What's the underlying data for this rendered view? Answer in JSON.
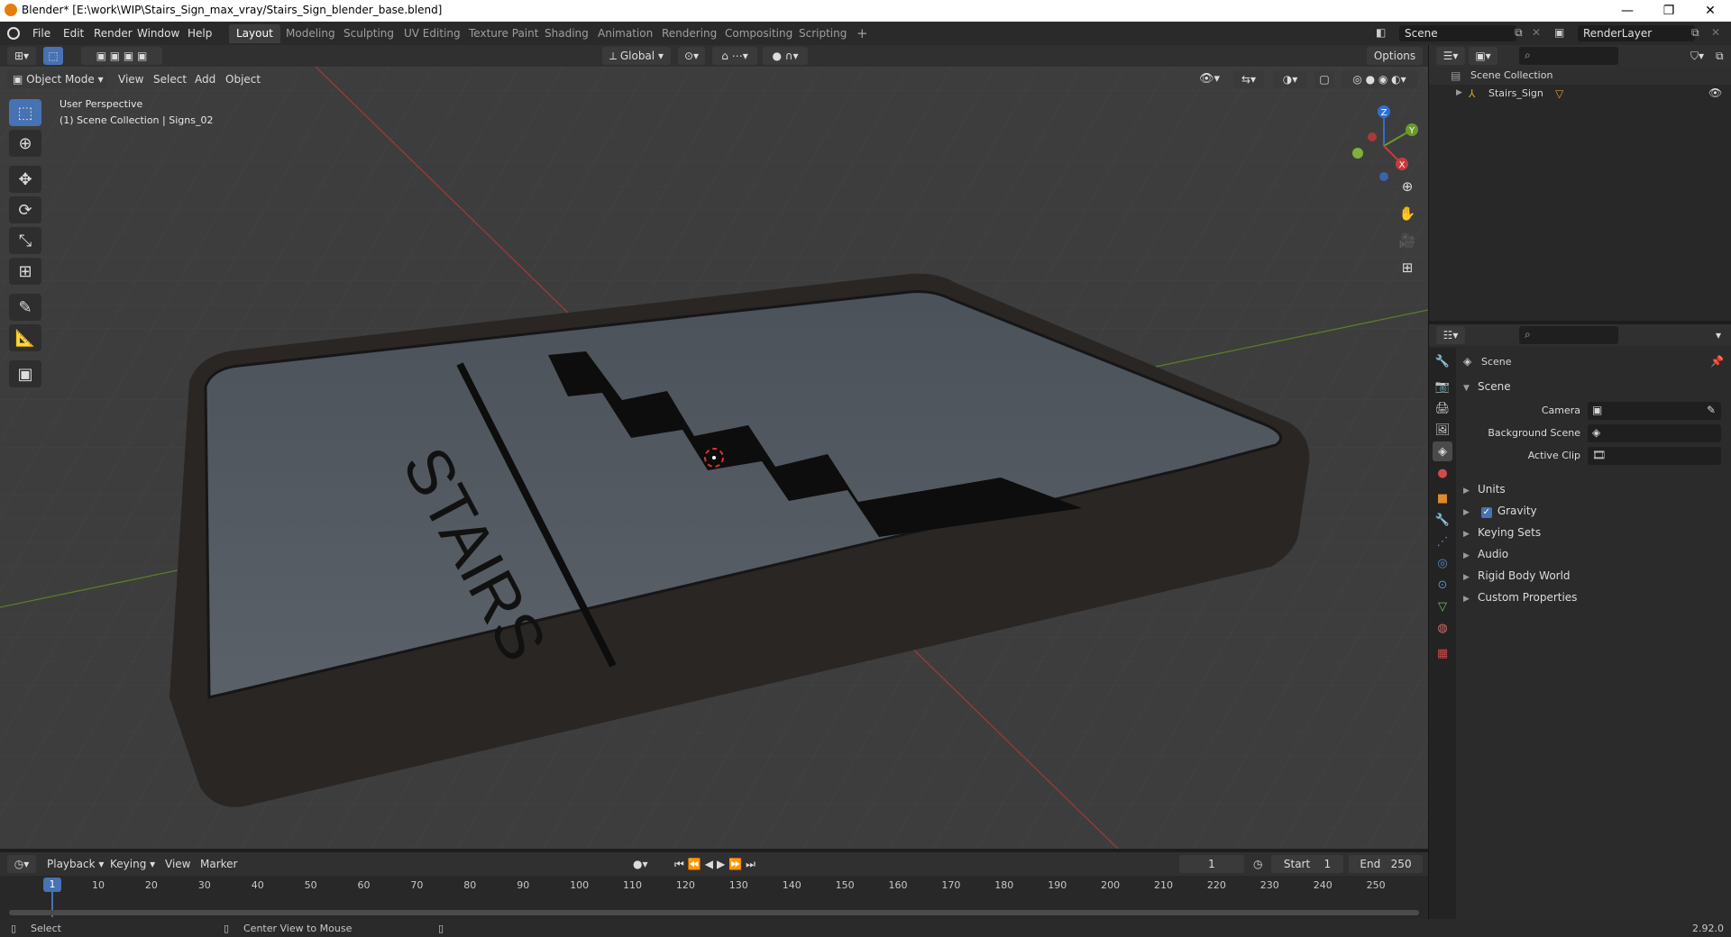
{
  "window": {
    "title": "Blender* [E:\\work\\WIP\\Stairs_Sign_max_vray/Stairs_Sign_blender_base.blend]",
    "minimize": "—",
    "maximize": "❐",
    "close": "✕"
  },
  "menu": [
    "File",
    "Edit",
    "Render",
    "Window",
    "Help"
  ],
  "workspaces": [
    {
      "label": "Layout",
      "active": true
    },
    {
      "label": "Modeling"
    },
    {
      "label": "Sculpting"
    },
    {
      "label": "UV Editing"
    },
    {
      "label": "Texture Paint"
    },
    {
      "label": "Shading"
    },
    {
      "label": "Animation"
    },
    {
      "label": "Rendering"
    },
    {
      "label": "Compositing"
    },
    {
      "label": "Scripting"
    }
  ],
  "add_workspace": "+",
  "scene_field": "Scene",
  "render_layer_field": "RenderLayer",
  "viewport_header": {
    "transform_orientation": "Global",
    "options": "Options"
  },
  "viewport_menu": {
    "mode": "Object Mode",
    "items": [
      "View",
      "Select",
      "Add",
      "Object"
    ]
  },
  "viewport_overlay": {
    "perspective": "User Perspective",
    "collection": "(1) Scene Collection | Signs_02"
  },
  "sign_text": "STAIRS",
  "gizmo": {
    "z": "Z",
    "y": "Y",
    "x": "X"
  },
  "outliner": {
    "root": "Scene Collection",
    "items": [
      {
        "label": "Stairs_Sign"
      }
    ]
  },
  "properties": {
    "context": "Scene",
    "panel_title": "Scene",
    "fields": [
      {
        "label": "Camera"
      },
      {
        "label": "Background Scene"
      },
      {
        "label": "Active Clip"
      }
    ],
    "sections": [
      {
        "label": "Units",
        "checkbox": false
      },
      {
        "label": "Gravity",
        "checkbox": true,
        "checked": true
      },
      {
        "label": "Keying Sets",
        "checkbox": false
      },
      {
        "label": "Audio",
        "checkbox": false
      },
      {
        "label": "Rigid Body World",
        "checkbox": false
      },
      {
        "label": "Custom Properties",
        "checkbox": false
      }
    ]
  },
  "timeline": {
    "menus": [
      "Playback",
      "Keying",
      "View",
      "Marker"
    ],
    "current_frame": "1",
    "start_label": "Start",
    "start": "1",
    "end_label": "End",
    "end": "250",
    "ticks": [
      "1",
      "10",
      "20",
      "30",
      "40",
      "50",
      "60",
      "70",
      "80",
      "90",
      "100",
      "110",
      "120",
      "130",
      "140",
      "150",
      "160",
      "170",
      "180",
      "190",
      "200",
      "210",
      "220",
      "230",
      "240",
      "250"
    ],
    "playhead": "1"
  },
  "statusbar": {
    "left": "Select",
    "middle": "Center View to Mouse",
    "version": "2.92.0"
  },
  "colors": {
    "accent": "#4772b3",
    "x_axis": "#c93a3a",
    "y_axis": "#6a9a2a",
    "z_axis": "#2f6fd1"
  }
}
